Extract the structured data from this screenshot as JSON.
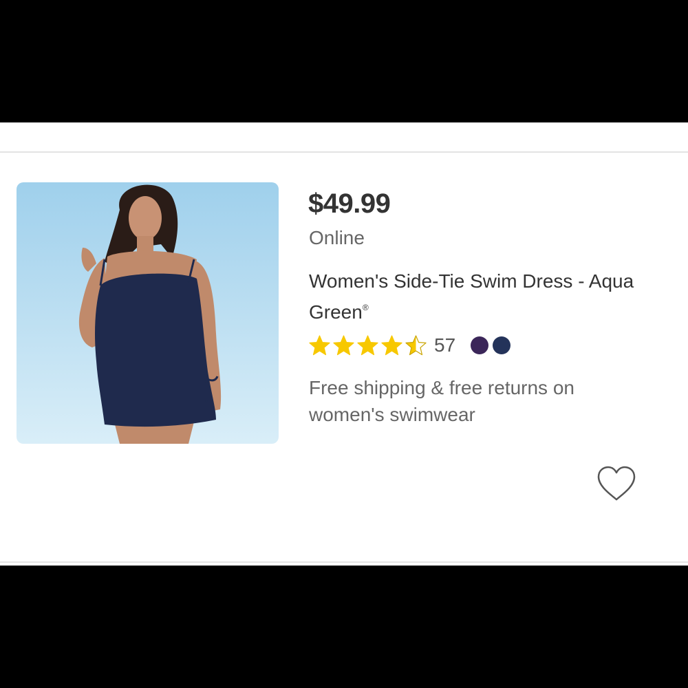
{
  "product": {
    "price": "$49.99",
    "availability": "Online",
    "title": "Women's Side-Tie Swim Dress - Aqua Green",
    "trademark": "®",
    "rating": 4.5,
    "rating_max": 5,
    "review_count": "57",
    "shipping_note": "Free shipping & free returns on women's swimwear",
    "image_icon": "product-photo-swim-dress",
    "favorite_icon": "heart-outline-icon"
  },
  "swatches": [
    {
      "name": "purple-swatch",
      "color": "#3b2659"
    },
    {
      "name": "navy-swatch",
      "color": "#24335a"
    }
  ],
  "colors": {
    "star": "#f7c800",
    "text_primary": "#333333",
    "text_secondary": "#666666",
    "background": "#ffffff"
  }
}
